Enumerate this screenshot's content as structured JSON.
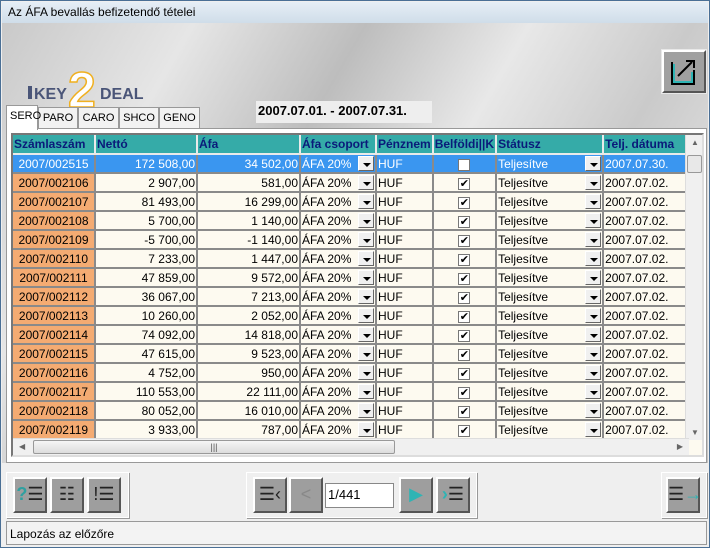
{
  "window": {
    "title": "Az ÁFA bevallás befizetendő tételei"
  },
  "logo": {
    "text": "KEY2DEAL",
    "key": "KEY",
    "two": "2",
    "deal": "DEAL"
  },
  "header": {
    "date_range": "2007.07.01. - 2007.07.31."
  },
  "tabs": [
    {
      "label": "SERO",
      "active": true
    },
    {
      "label": "PARO"
    },
    {
      "label": "CARO"
    },
    {
      "label": "SHCO"
    },
    {
      "label": "GENO"
    }
  ],
  "table": {
    "columns": [
      "Számlaszám",
      "Nettó",
      "Áfa",
      "Áfa csoport",
      "Pénznem",
      "Belföldi||K",
      "Státusz",
      "Telj. dátuma"
    ],
    "rows": [
      {
        "id": "2007/002515",
        "netto": "172 508,00",
        "afa": "34 502,00",
        "group": "ÁFA 20%",
        "cur": "HUF",
        "dom": false,
        "status": "Teljesítve",
        "date": "2007.07.30.",
        "selected": true
      },
      {
        "id": "2007/002106",
        "netto": "2 907,00",
        "afa": "581,00",
        "group": "ÁFA 20%",
        "cur": "HUF",
        "dom": true,
        "status": "Teljesítve",
        "date": "2007.07.02."
      },
      {
        "id": "2007/002107",
        "netto": "81 493,00",
        "afa": "16 299,00",
        "group": "ÁFA 20%",
        "cur": "HUF",
        "dom": true,
        "status": "Teljesítve",
        "date": "2007.07.02."
      },
      {
        "id": "2007/002108",
        "netto": "5 700,00",
        "afa": "1 140,00",
        "group": "ÁFA 20%",
        "cur": "HUF",
        "dom": true,
        "status": "Teljesítve",
        "date": "2007.07.02."
      },
      {
        "id": "2007/002109",
        "netto": "-5 700,00",
        "afa": "-1 140,00",
        "group": "ÁFA 20%",
        "cur": "HUF",
        "dom": true,
        "status": "Teljesítve",
        "date": "2007.07.02."
      },
      {
        "id": "2007/002110",
        "netto": "7 233,00",
        "afa": "1 447,00",
        "group": "ÁFA 20%",
        "cur": "HUF",
        "dom": true,
        "status": "Teljesítve",
        "date": "2007.07.02."
      },
      {
        "id": "2007/002111",
        "netto": "47 859,00",
        "afa": "9 572,00",
        "group": "ÁFA 20%",
        "cur": "HUF",
        "dom": true,
        "status": "Teljesítve",
        "date": "2007.07.02."
      },
      {
        "id": "2007/002112",
        "netto": "36 067,00",
        "afa": "7 213,00",
        "group": "ÁFA 20%",
        "cur": "HUF",
        "dom": true,
        "status": "Teljesítve",
        "date": "2007.07.02."
      },
      {
        "id": "2007/002113",
        "netto": "10 260,00",
        "afa": "2 052,00",
        "group": "ÁFA 20%",
        "cur": "HUF",
        "dom": true,
        "status": "Teljesítve",
        "date": "2007.07.02."
      },
      {
        "id": "2007/002114",
        "netto": "74 092,00",
        "afa": "14 818,00",
        "group": "ÁFA 20%",
        "cur": "HUF",
        "dom": true,
        "status": "Teljesítve",
        "date": "2007.07.02."
      },
      {
        "id": "2007/002115",
        "netto": "47 615,00",
        "afa": "9 523,00",
        "group": "ÁFA 20%",
        "cur": "HUF",
        "dom": true,
        "status": "Teljesítve",
        "date": "2007.07.02."
      },
      {
        "id": "2007/002116",
        "netto": "4 752,00",
        "afa": "950,00",
        "group": "ÁFA 20%",
        "cur": "HUF",
        "dom": true,
        "status": "Teljesítve",
        "date": "2007.07.02."
      },
      {
        "id": "2007/002117",
        "netto": "110 553,00",
        "afa": "22 111,00",
        "group": "ÁFA 20%",
        "cur": "HUF",
        "dom": true,
        "status": "Teljesítve",
        "date": "2007.07.02."
      },
      {
        "id": "2007/002118",
        "netto": "80 052,00",
        "afa": "16 010,00",
        "group": "ÁFA 20%",
        "cur": "HUF",
        "dom": true,
        "status": "Teljesítve",
        "date": "2007.07.02."
      },
      {
        "id": "2007/002119",
        "netto": "3 933,00",
        "afa": "787,00",
        "group": "ÁFA 20%",
        "cur": "HUF",
        "dom": true,
        "status": "Teljesítve",
        "date": "2007.07.02."
      }
    ]
  },
  "pager": {
    "value": "1/441"
  },
  "toolbar": {
    "icons": [
      "query-list-icon",
      "list-icon",
      "alert-list-icon",
      "first-page-icon",
      "previous-page-icon",
      "next-page-icon",
      "last-page-icon",
      "exit-icon"
    ]
  },
  "status_bar": {
    "text": "Lapozás az előzőre"
  },
  "colors": {
    "header": "#35aba8",
    "selected": "#3a96f0",
    "id_cell": "#f4ab72",
    "accent": "#2fb4b4"
  }
}
